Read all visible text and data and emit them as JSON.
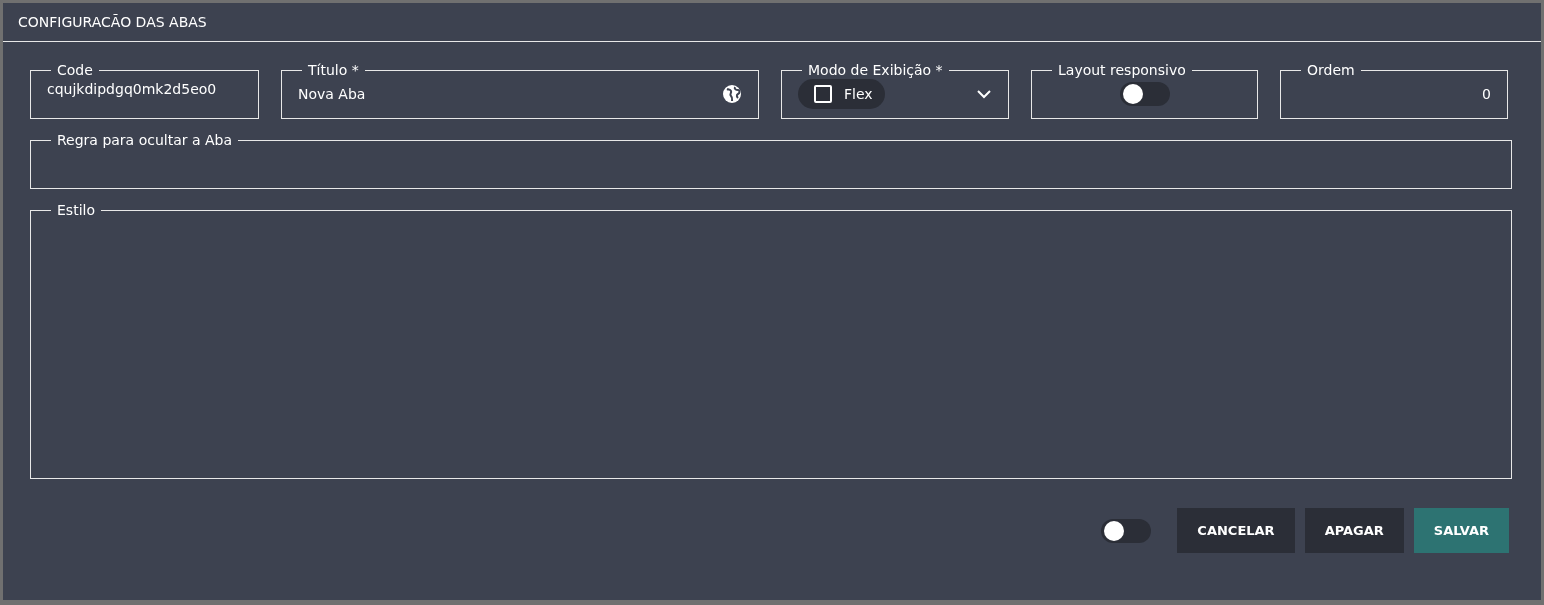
{
  "dialog": {
    "title": "CONFIGURACÃO DAS ABAS"
  },
  "fields": [
    {
      "kind": "text",
      "label": "Code",
      "value": "cqujkdipdgq0mk2d5eo0"
    },
    {
      "kind": "translatable",
      "label": "Título *",
      "value": "Nova Aba"
    },
    {
      "kind": "select",
      "label": "Modo de Exibição *",
      "chip": {
        "label": "Flex",
        "checked": false
      }
    },
    {
      "kind": "toggle",
      "label": "Layout responsivo",
      "on": false
    },
    {
      "kind": "number",
      "label": "Ordem",
      "value": "0"
    }
  ],
  "hide_rule": {
    "label": "Regra para ocultar a Aba"
  },
  "style": {
    "label": "Estilo"
  },
  "footer": {
    "toggle": {
      "on": false
    },
    "buttons": [
      {
        "label": "CANCELAR",
        "kind": "dark"
      },
      {
        "label": "APAGAR",
        "kind": "dark"
      },
      {
        "label": "SALVAR",
        "kind": "primary"
      }
    ]
  }
}
